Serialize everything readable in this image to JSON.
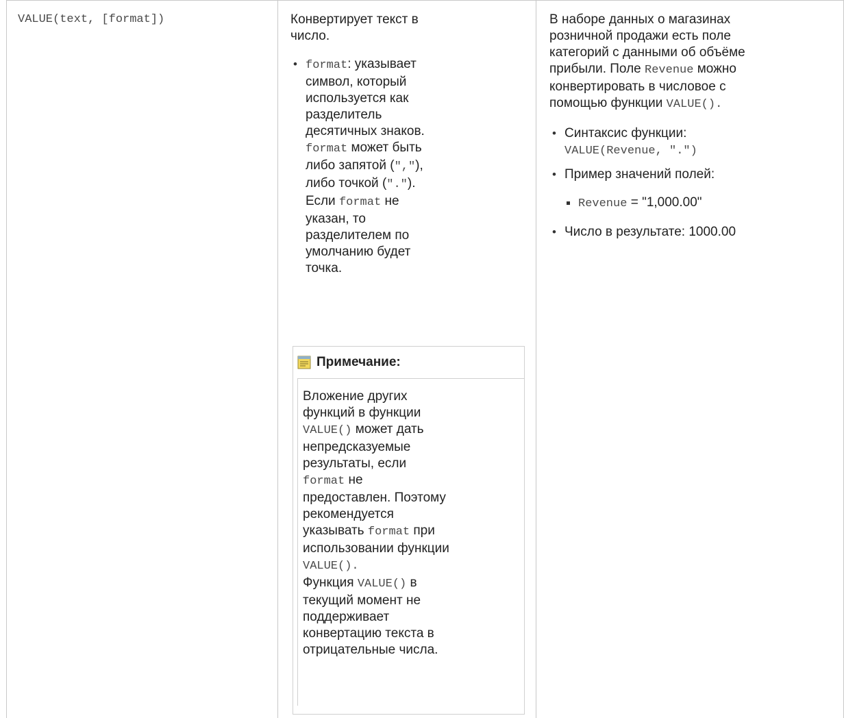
{
  "row": {
    "syntax": "VALUE(text, [format])",
    "description": {
      "intro_lines": [
        "Конвертирует текст в",
        "число."
      ],
      "param_bullet": {
        "name": "format",
        "line1_tail": ": указывает",
        "lines_a": [
          "символ, который",
          "используется как",
          "разделитель",
          "десятичных знаков."
        ],
        "line_b_code": "format",
        "line_b_tail": " может быть",
        "line_c_pre": "либо запятой (",
        "line_c_code": "\",\"",
        "line_c_post": "),",
        "line_d_pre": "либо точкой (",
        "line_d_code": "\".\"",
        "line_d_post": ").",
        "line_e_pre": "Если ",
        "line_e_code": "format",
        "line_e_post": " не",
        "lines_f": [
          "указан, то",
          "разделителем по",
          "умолчанию будет",
          "точка."
        ]
      },
      "note": {
        "icon": "note-icon",
        "title": "Примечание:",
        "lines_1": [
          "Вложение других",
          "функций в функции"
        ],
        "l3_code": "VALUE()",
        "l3_post": " может дать",
        "lines_2": [
          "непредсказуемые",
          "результаты, если"
        ],
        "l6_code": "format",
        "l6_post": " не",
        "lines_3": [
          "предоставлен. Поэтому",
          "рекомендуется"
        ],
        "l9_pre": "указывать ",
        "l9_code": "format",
        "l9_post": " при",
        "l10": "использовании функции",
        "l11_code": "VALUE().",
        "l12_pre": "Функция ",
        "l12_code": "VALUE()",
        "l12_post": " в",
        "lines_4": [
          "текущий момент не",
          "поддерживает",
          "конвертацию текста в",
          "отрицательные числа."
        ]
      }
    },
    "example": {
      "lines_1": [
        "В наборе данных о магазинах",
        "розничной продажи есть поле",
        "категорий с данными об объёме"
      ],
      "l4_pre": "прибыли. Поле ",
      "l4_code": "Revenue",
      "l4_post": " можно",
      "l5": "конвертировать в числовое с",
      "l6_pre": "помощью функции ",
      "l6_code": "VALUE().",
      "bullets": {
        "b1_label": "Синтаксис функции:",
        "b1_code": "VALUE(Revenue, \".\")",
        "b2_label": "Пример значений полей:",
        "sub_code": "Revenue",
        "sub_rest": " = \"1,000.00\"",
        "b3": "Число в результате: 1000.00"
      }
    }
  },
  "colors": {
    "border": "#c8c8c8",
    "text": "#222222",
    "code": "#4a4a4a",
    "note_icon": "#e8cf5a"
  }
}
